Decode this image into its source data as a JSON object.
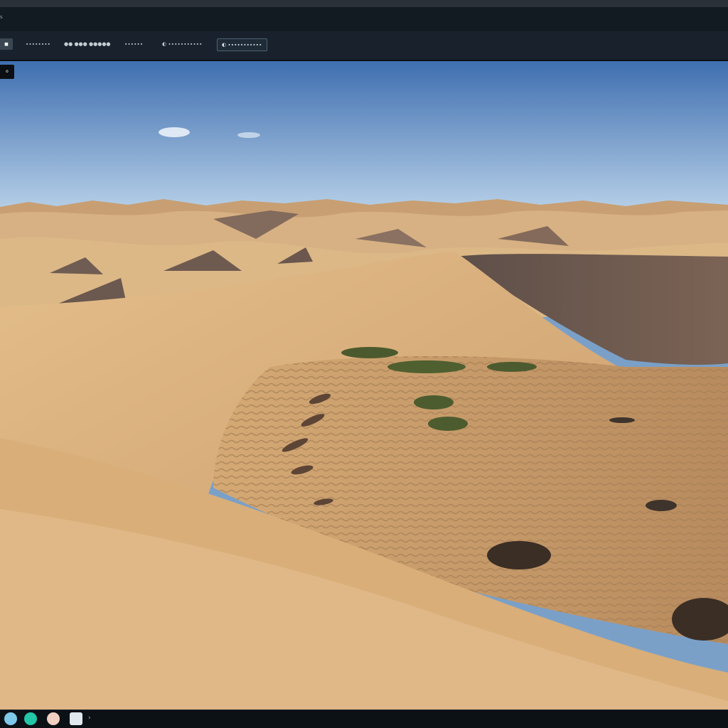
{
  "window": {
    "title": "s",
    "badge": "o"
  },
  "toolbar": {
    "items": [
      {
        "label": "◼"
      },
      {
        "label": "∙∙∙∙∙∙∙∙"
      },
      {
        "label": "●● ●●● ●●●●●"
      },
      {
        "label": "∙∙∙∙∙∙"
      },
      {
        "label": "◐ ∙∙∙∙∙∙∙∙∙∙∙"
      },
      {
        "label": "◐ ∙∙∙∙∙∙∙∙∙∙∙"
      }
    ]
  },
  "taskbar": {
    "arrow": "›",
    "icons": [
      "globe-icon",
      "teal-app-icon",
      "colorful-app-icon",
      "mail-icon"
    ]
  },
  "colors": {
    "sky_top": "#3f6fb0",
    "sky_bottom": "#bcd4ea",
    "sand_light": "#e3bd8a",
    "sand_mid": "#cda06e",
    "sand_shadow": "#7b6354"
  }
}
